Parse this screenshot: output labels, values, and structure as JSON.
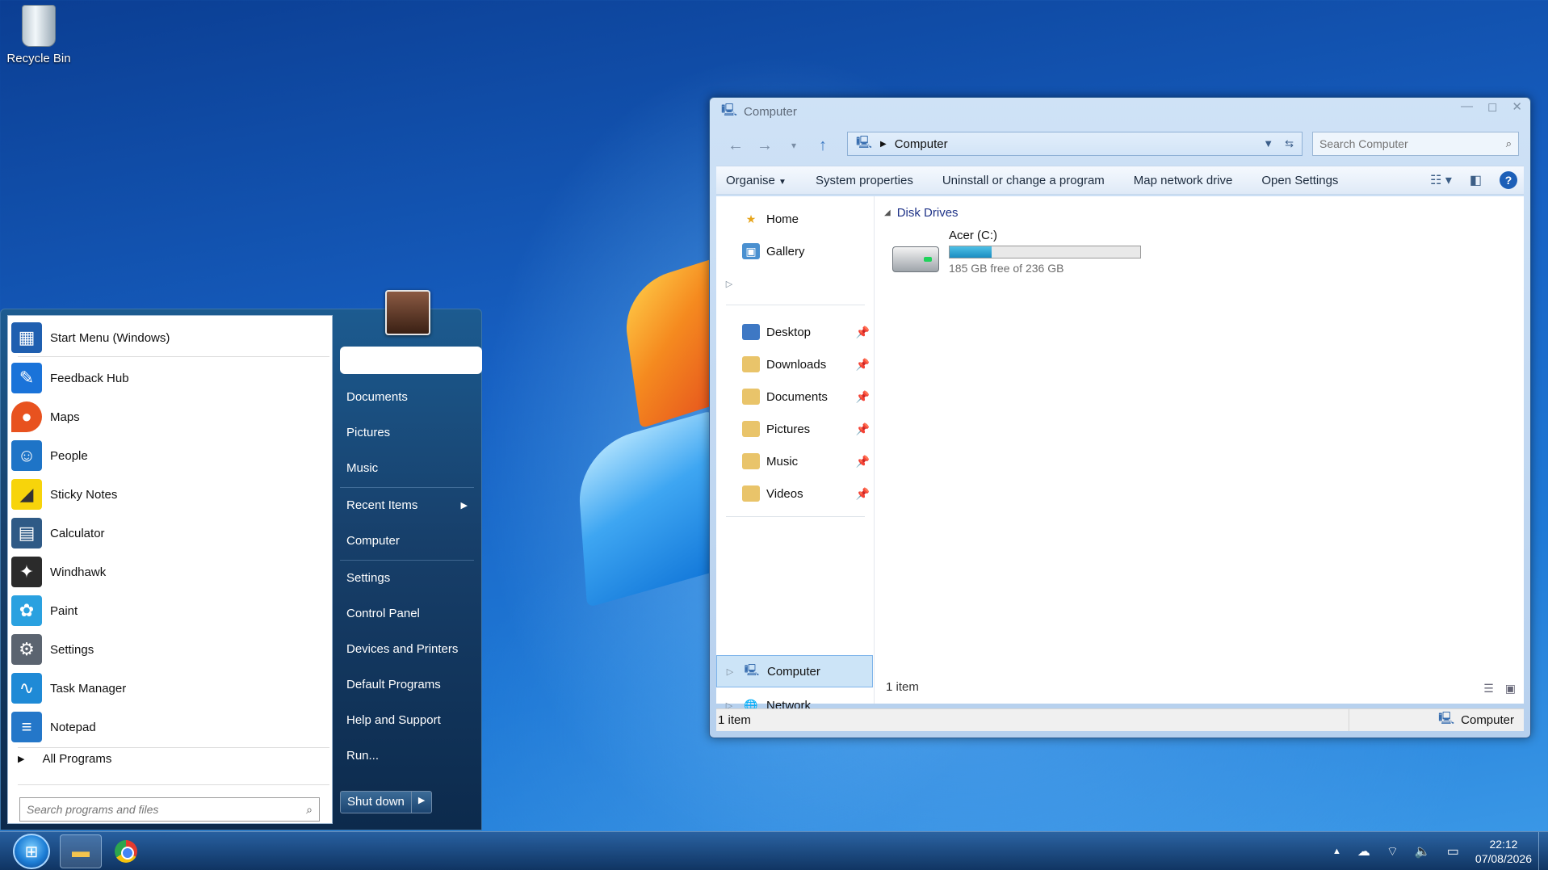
{
  "desktop": {
    "icons": [
      {
        "label": "Recycle Bin",
        "icon": "recycle-bin-icon"
      }
    ]
  },
  "start_menu": {
    "programs": [
      {
        "label": "Start Menu (Windows)",
        "icon": "start-menu-icon",
        "color": "#1f5fb0"
      },
      {
        "label": "Feedback Hub",
        "icon": "feedback-hub-icon",
        "color": "#1a73d9"
      },
      {
        "label": "Maps",
        "icon": "maps-icon",
        "color": "#e8521f"
      },
      {
        "label": "People",
        "icon": "people-icon",
        "color": "#1e74c7"
      },
      {
        "label": "Sticky Notes",
        "icon": "sticky-notes-icon",
        "color": "#f7d40b"
      },
      {
        "label": "Calculator",
        "icon": "calculator-icon",
        "color": "#2f5a86"
      },
      {
        "label": "Windhawk",
        "icon": "windhawk-icon",
        "color": "#2b2b2b"
      },
      {
        "label": "Paint",
        "icon": "paint-icon",
        "color": "#2aa1e0"
      },
      {
        "label": "Settings",
        "icon": "settings-icon",
        "color": "#5b6470"
      },
      {
        "label": "Task Manager",
        "icon": "task-manager-icon",
        "color": "#1f8ad6"
      },
      {
        "label": "Notepad",
        "icon": "notepad-icon",
        "color": "#2477c9"
      }
    ],
    "all_programs": "All Programs",
    "search_placeholder": "Search programs and files",
    "right_items": [
      "Documents",
      "Pictures",
      "Music",
      "Recent Items",
      "Computer",
      "Settings",
      "Control Panel",
      "Devices and Printers",
      "Default Programs",
      "Help and Support",
      "Run..."
    ],
    "shutdown_label": "Shut down"
  },
  "explorer": {
    "title": "Computer",
    "address": "Computer",
    "search_placeholder": "Search Computer",
    "commands": [
      "Organise",
      "System properties",
      "Uninstall or change a program",
      "Map network drive",
      "Open Settings"
    ],
    "nav_top": [
      {
        "label": "Home",
        "icon": "home-star-icon"
      },
      {
        "label": "Gallery",
        "icon": "gallery-icon"
      }
    ],
    "quick_access": [
      {
        "label": "Desktop",
        "icon": "desktop-folder-icon"
      },
      {
        "label": "Downloads",
        "icon": "downloads-folder-icon"
      },
      {
        "label": "Documents",
        "icon": "documents-folder-icon"
      },
      {
        "label": "Pictures",
        "icon": "pictures-folder-icon"
      },
      {
        "label": "Music",
        "icon": "music-folder-icon"
      },
      {
        "label": "Videos",
        "icon": "videos-folder-icon"
      }
    ],
    "nav_bottom": [
      {
        "label": "Computer",
        "icon": "computer-icon",
        "selected": true
      },
      {
        "label": "Network",
        "icon": "network-icon",
        "selected": false
      }
    ],
    "group_header": "Disk Drives",
    "drive": {
      "name": "Acer (C:)",
      "free_text": "185 GB free of 236 GB",
      "used_fraction": 0.22
    },
    "items_count": "1 item",
    "status_left": "1 item",
    "status_right": "Computer"
  },
  "taskbar": {
    "apps": [
      "file-explorer-icon",
      "chrome-icon"
    ],
    "time": "22:12",
    "date": "07/08/2026"
  }
}
